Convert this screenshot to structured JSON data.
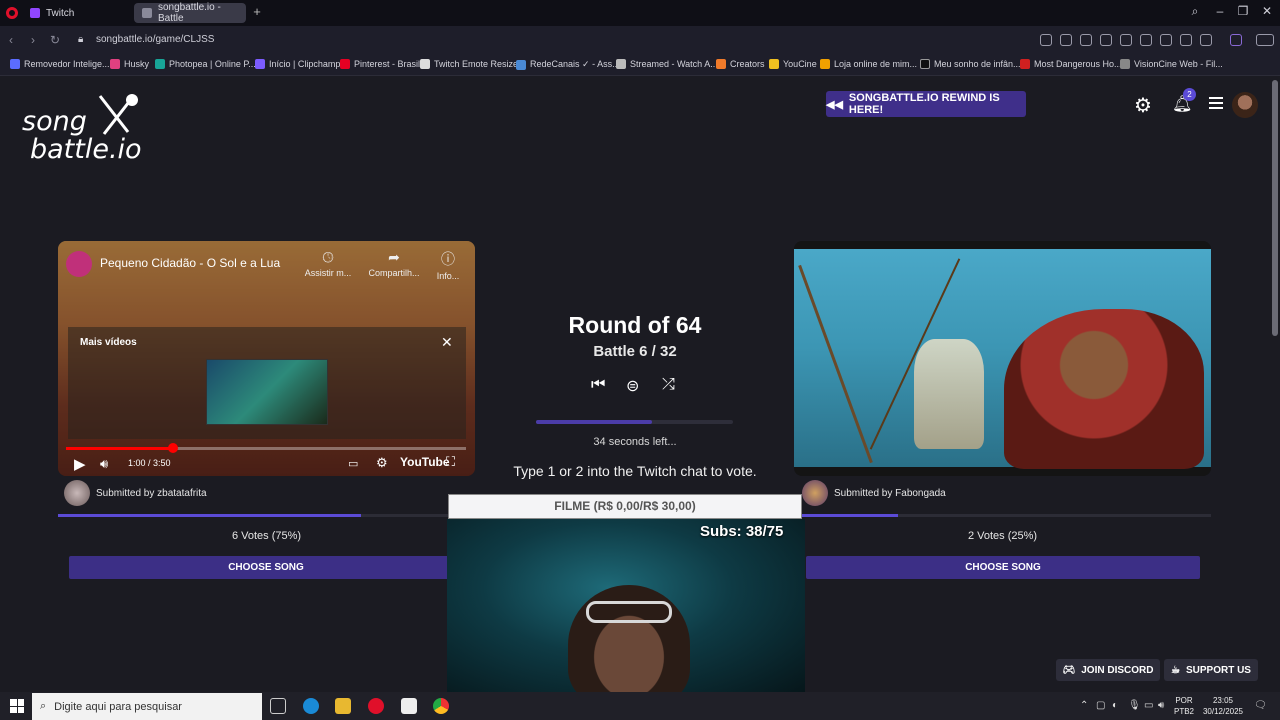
{
  "browser": {
    "tabs": [
      {
        "label": "Twitch"
      },
      {
        "label": "songbattle.io - Battle"
      }
    ],
    "url": "songbattle.io/game/CLJSS",
    "bookmarks": [
      "Removedor Intelige...",
      "Husky",
      "Photopea | Online P...",
      "Início | Clipchamp",
      "Pinterest - Brasil",
      "Twitch Emote Resizer",
      "RedeCanais ✓ - Ass...",
      "Streamed - Watch A...",
      "Creators",
      "YouCine",
      "Loja online de mim...",
      "Meu sonho de infân...",
      "Most Dangerous Ho...",
      "VisionCine Web - Fil..."
    ],
    "accent": "#e0102a"
  },
  "header": {
    "logo_line1": "song",
    "logo_line2": "battle.io",
    "rewind_label": "SONGBATTLE.IO REWIND IS HERE!",
    "notification_count": "2"
  },
  "left_video": {
    "title": "Pequeno Cidadão - O Sol e a Lua",
    "watch_later": "Assistir m...",
    "share": "Compartilh...",
    "info": "Info...",
    "more_videos": "Mais vídeos",
    "time": "1:00 / 3:50",
    "youtube": "YouTube",
    "submitter": "Submitted by zbatatafrita",
    "votes": "6 Votes (75%)",
    "vote_fraction": 0.75,
    "choose": "CHOOSE SONG"
  },
  "right_video": {
    "submitter": "Submitted by Fabongada",
    "votes": "2 Votes (25%)",
    "vote_fraction": 0.25,
    "choose": "CHOOSE SONG"
  },
  "center": {
    "round": "Round of 64",
    "battle": "Battle 6 / 32",
    "seconds_left": "34 seconds left...",
    "instruction": "Type 1 or 2 into the Twitch chat to vote.",
    "timer_fraction": 0.59
  },
  "overlay": {
    "bar_text": "FILME (R$ 0,00/R$ 30,00)",
    "subs": "Subs: 38/75"
  },
  "footer": {
    "discord": "JOIN DISCORD",
    "support": "SUPPORT US"
  },
  "taskbar": {
    "search_placeholder": "Digite aqui para pesquisar",
    "lang1": "POR",
    "lang2": "PTB2",
    "time": "23:05",
    "date": "30/12/2025"
  },
  "colors": {
    "brand_purple": "#3c2f86",
    "vote_fill": "#5b4bd6",
    "background": "#1b1b22"
  }
}
